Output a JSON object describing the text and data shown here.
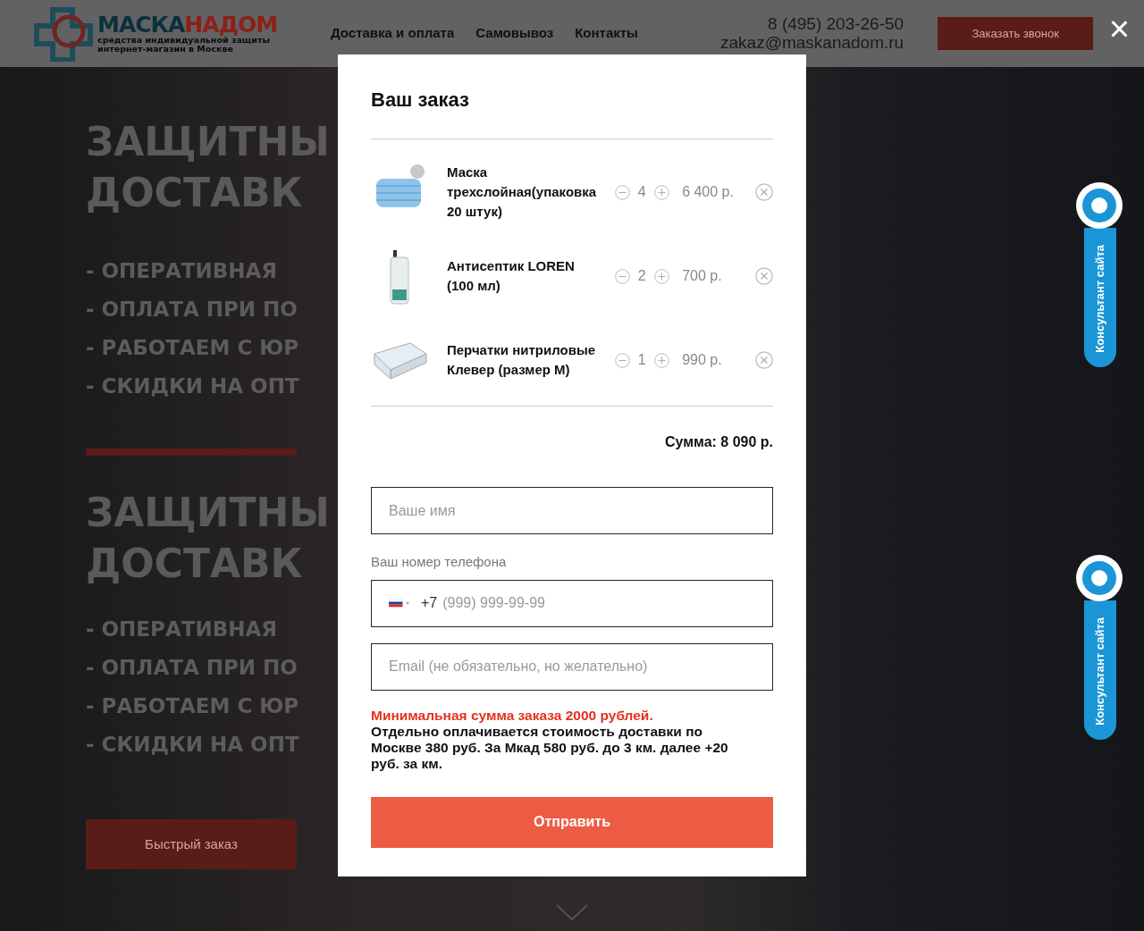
{
  "header": {
    "logo": {
      "name_dark": "МАСКА",
      "name_accent": "НАДОМ",
      "tagline": [
        "средства индивидуальной защиты",
        "интернет-магазин в Москве"
      ]
    },
    "nav": [
      {
        "label": "Доставка и оплата"
      },
      {
        "label": "Самовывоз"
      },
      {
        "label": "Контакты"
      }
    ],
    "phone": "8 (495) 203-26-50",
    "email": "zakaz@maskanadom.ru",
    "callback_button": "Заказать звонок"
  },
  "close_label": "×",
  "hero_sections": [
    {
      "title_lines": [
        "ЗАЩИТНЫ",
        "ДОСТАВК"
      ],
      "bullets": [
        "- ОПЕРАТИВНАЯ",
        "- ОПЛАТА ПРИ ПО",
        "- РАБОТАЕМ С ЮР",
        "- СКИДКИ НА ОПТ"
      ]
    },
    {
      "title_lines": [
        "ЗАЩИТНЫ",
        "ДОСТАВК"
      ],
      "bullets": [
        "- ОПЕРАТИВНАЯ",
        "- ОПЛАТА ПРИ ПО",
        "- РАБОТАЕМ С ЮР",
        "- СКИДКИ НА ОПТ"
      ],
      "button": "Быстрый заказ"
    }
  ],
  "modal": {
    "title": "Ваш заказ",
    "items": [
      {
        "kind": "mask",
        "name": "Маска трехслойная(упаковка 20 штук)",
        "quantity": "4",
        "price": "6 400 р."
      },
      {
        "kind": "bottle",
        "name": "Антисептик LOREN (100 мл)",
        "quantity": "2",
        "price": "700 р."
      },
      {
        "kind": "box",
        "name": "Перчатки нитриловые Клевер (размер М)",
        "quantity": "1",
        "price": "990 р."
      }
    ],
    "total": "Сумма: 8 090 р.",
    "name_field": {
      "placeholder": "Ваше имя"
    },
    "phone_label": "Ваш номер телефона",
    "phone_field": {
      "prefix": "+7",
      "placeholder": "(999) 999-99-99"
    },
    "email_field": {
      "placeholder": "Email (не обязательно, но желательно)"
    },
    "notice_warning": "Минимальная сумма заказа 2000 рублей.",
    "notice_text": "Отдельно оплачивается стоимость доставки по Москве 380 руб. За Мкад 580 руб. до 3 км. далее +20 руб. за км.",
    "submit": "Отправить"
  },
  "consultant_widgets": [
    {
      "label": "Консультант сайта"
    },
    {
      "label": "Консультант сайта"
    }
  ]
}
